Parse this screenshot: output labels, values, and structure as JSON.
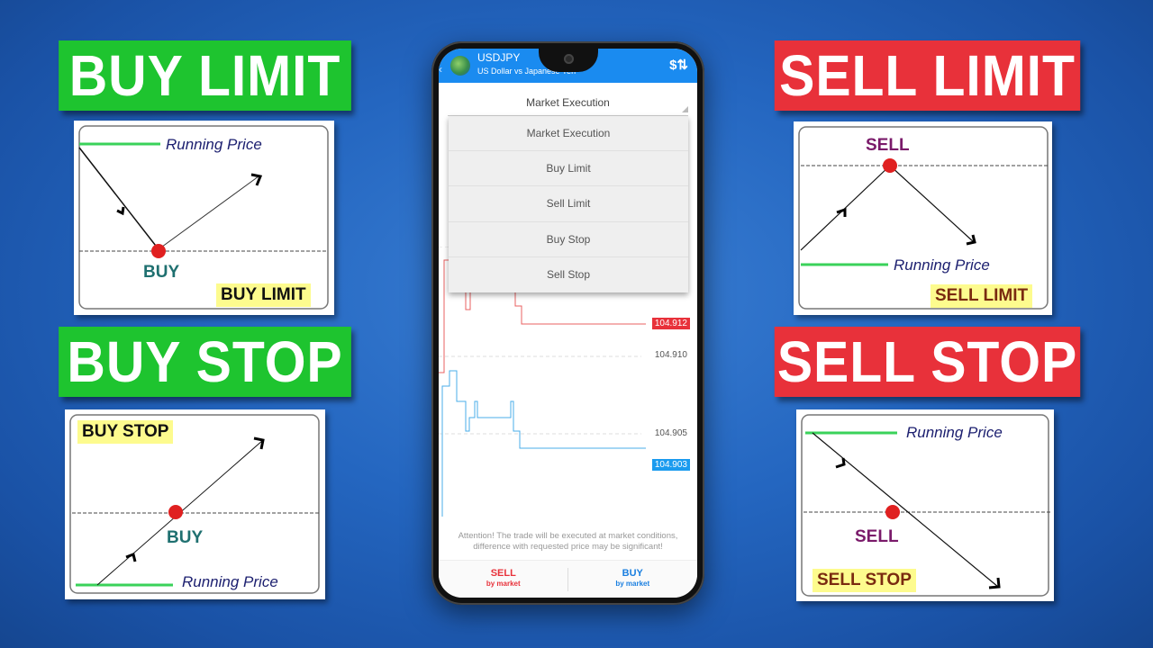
{
  "banners": {
    "buy_limit": "BUY LIMIT",
    "buy_stop": "BUY STOP",
    "sell_limit": "SELL LIMIT",
    "sell_stop": "SELL STOP"
  },
  "cards": {
    "buy_limit": {
      "running_price": "Running Price",
      "action": "BUY",
      "tag": "BUY LIMIT"
    },
    "buy_stop": {
      "running_price": "Running Price",
      "action": "BUY",
      "tag": "BUY STOP"
    },
    "sell_limit": {
      "running_price": "Running Price",
      "action": "SELL",
      "tag": "SELL LIMIT"
    },
    "sell_stop": {
      "running_price": "Running Price",
      "action": "SELL",
      "tag": "SELL STOP"
    }
  },
  "colors": {
    "buy_banner": "#1ec42f",
    "sell_banner": "#e8313a",
    "app_bar": "#1a8bf0",
    "ask_line": "#e8313a",
    "bid_line": "#1a9bef",
    "tag_highlight": "#fdfb8e"
  },
  "phone": {
    "symbol": "USDJPY",
    "symbol_description": "US Dollar vs Japanese Yen",
    "icons": {
      "back": "back-arrow-icon",
      "logo": "metatrader-logo-icon",
      "quote": "dollar-exchange-icon"
    },
    "order_type": "Market Execution",
    "dropdown_options": [
      "Market Execution",
      "Buy Limit",
      "Sell Limit",
      "Buy Stop",
      "Sell Stop"
    ],
    "chart": {
      "ask_price": "104.912",
      "bid_price": "104.903",
      "gridlines": [
        "104.910",
        "104.905"
      ]
    },
    "warning": "Attention! The trade will be executed at market conditions, difference with requested price may be significant!",
    "sell_button": {
      "label": "SELL",
      "sublabel": "by market"
    },
    "buy_button": {
      "label": "BUY",
      "sublabel": "by market"
    }
  }
}
